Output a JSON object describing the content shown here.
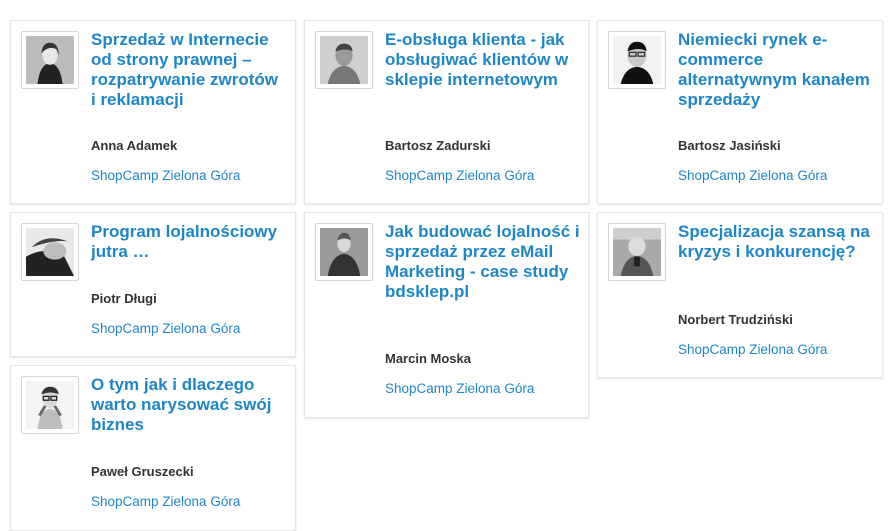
{
  "talks": [
    {
      "title": "Sprzedaż w Internecie od strony prawnej – rozpatrywanie zwrotów i reklamacji",
      "author": "Anna Adamek",
      "event": "ShopCamp Zielona Góra"
    },
    {
      "title": "E-obsługa klienta - jak obsługiwać klientów w sklepie internetowym",
      "author": "Bartosz Zadurski",
      "event": "ShopCamp Zielona Góra"
    },
    {
      "title": "Niemiecki rynek e-commerce alternatywnym kanałem sprzedaży",
      "author": "Bartosz Jasiński",
      "event": "ShopCamp Zielona Góra"
    },
    {
      "title": "Program lojalnościowy jutra …",
      "author": "Piotr Długi",
      "event": "ShopCamp Zielona Góra"
    },
    {
      "title": "Jak budować lojalność i sprzedaż przez eMail Marketing - case study bdsklep.pl",
      "author": "Marcin Moska",
      "event": "ShopCamp Zielona Góra"
    },
    {
      "title": "Specjalizacja szansą na kryzys i konkurencję?",
      "author": "Norbert Trudziński",
      "event": "ShopCamp Zielona Góra"
    },
    {
      "title": "O tym jak i dlaczego warto narysować swój biznes",
      "author": "Paweł Gruszecki",
      "event": "ShopCamp Zielona Góra"
    }
  ]
}
